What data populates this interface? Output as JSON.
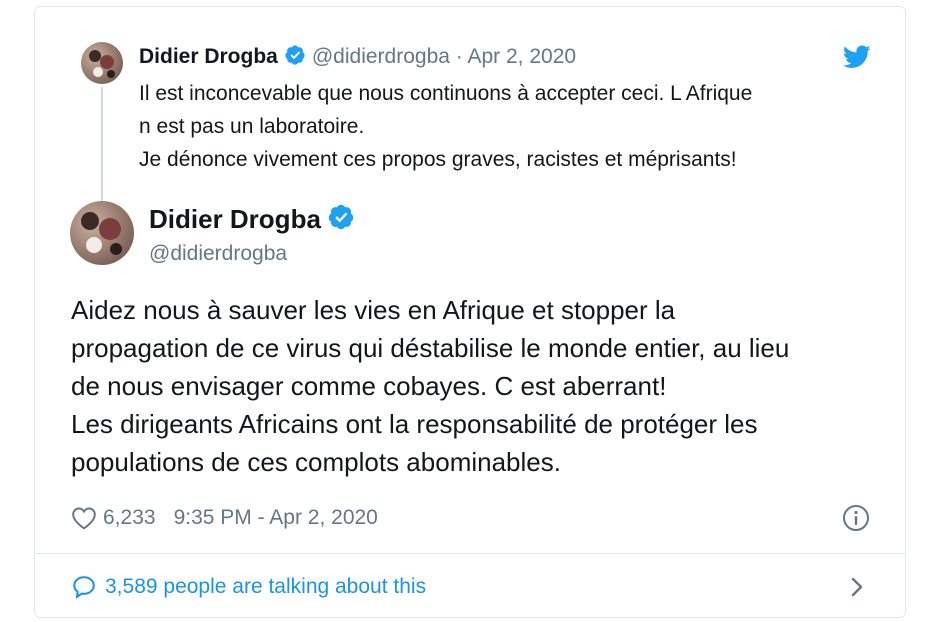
{
  "quoted_tweet": {
    "author_name": "Didier Drogba",
    "handle": "@didierdrogba",
    "separator": "·",
    "date": "Apr 2, 2020",
    "text_lines": [
      "Il est inconcevable que nous continuons à accepter ceci. L Afrique",
      "n est pas un laboratoire.",
      "Je dénonce vivement ces propos graves, racistes et méprisants!"
    ]
  },
  "main_tweet": {
    "author_name": "Didier Drogba",
    "handle": "@didierdrogba",
    "text_lines": [
      "Aidez nous à sauver les vies en Afrique et stopper la",
      "propagation de ce virus qui déstabilise le monde entier, au lieu",
      "de nous envisager comme cobayes. C est aberrant!",
      "Les dirigeants Africains ont la responsabilité de protéger les",
      "populations de ces complots abominables."
    ],
    "likes": "6,233",
    "timestamp": "9:35 PM - Apr 2, 2020"
  },
  "footer": {
    "talking_text": "3,589 people are talking about this"
  },
  "icons": {
    "verified": "verified-badge-icon",
    "bird": "twitter-bird-icon",
    "like": "heart-icon",
    "info": "info-icon",
    "reply": "speech-bubble-icon",
    "chevron": "chevron-right-icon"
  },
  "colors": {
    "twitter_blue": "#1da1f2",
    "link_blue": "#1b95e0",
    "muted": "#657786",
    "text": "#14171a",
    "border": "#e1e8ed"
  }
}
